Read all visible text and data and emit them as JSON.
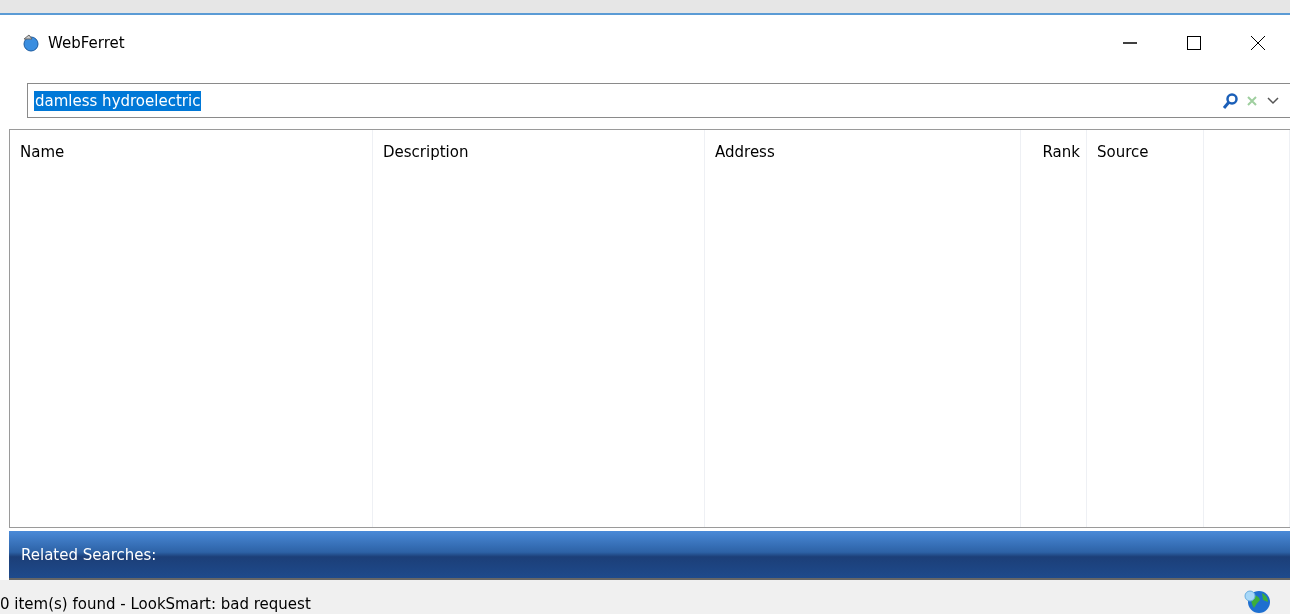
{
  "window": {
    "title": "WebFerret"
  },
  "search": {
    "value": "damless hydroelectric",
    "selected": true
  },
  "table": {
    "columns": [
      {
        "label": "Name"
      },
      {
        "label": "Description"
      },
      {
        "label": "Address"
      },
      {
        "label": "Rank"
      },
      {
        "label": "Source"
      }
    ]
  },
  "related": {
    "label": "Related Searches:"
  },
  "status_bar": {
    "text": "0 item(s) found - LookSmart: bad request"
  }
}
